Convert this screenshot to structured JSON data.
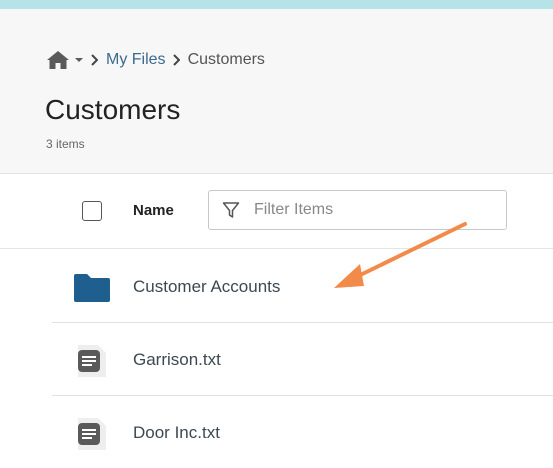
{
  "breadcrumb": {
    "home_icon": "home-icon",
    "items": [
      {
        "label": "My Files"
      },
      {
        "label": "Customers"
      }
    ]
  },
  "page": {
    "title": "Customers",
    "item_count": "3 items"
  },
  "toolbar": {
    "column_name_label": "Name",
    "filter_placeholder": "Filter Items"
  },
  "files": [
    {
      "name": "Customer Accounts",
      "type": "folder",
      "icon": "folder-icon"
    },
    {
      "name": "Garrison.txt",
      "type": "file",
      "icon": "text-file-icon"
    },
    {
      "name": "Door Inc.txt",
      "type": "file",
      "icon": "text-file-icon"
    }
  ],
  "colors": {
    "top_accent": "#b6e3e8",
    "folder": "#1f5f8f",
    "link": "#3b6a8f",
    "annotation_arrow": "#f28a4a",
    "file_icon": "#5a5a5a"
  }
}
